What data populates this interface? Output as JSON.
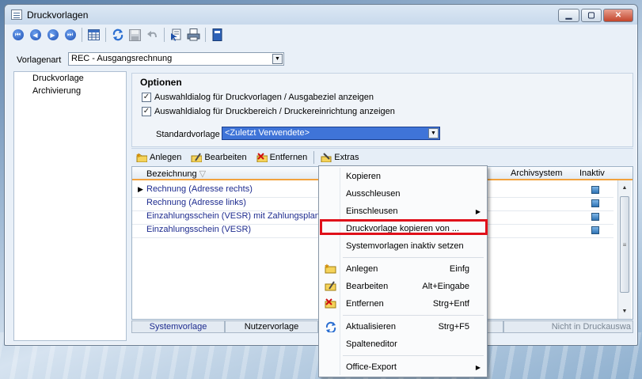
{
  "window": {
    "title": "Druckvorlagen"
  },
  "vorlagenart": {
    "label": "Vorlagenart",
    "value": "REC - Ausgangsrechnung"
  },
  "side": {
    "items": [
      "Druckvorlage",
      "Archivierung"
    ]
  },
  "optionen": {
    "title": "Optionen",
    "checkbox1": "Auswahldialog für Druckvorlagen / Ausgabeziel anzeigen",
    "checkbox2": "Auswahldialog für Druckbereich / Druckereinrichtung anzeigen",
    "std_label": "Standardvorlage",
    "std_value": "<Zuletzt Verwendete>"
  },
  "gridtb": {
    "anlegen": "Anlegen",
    "bearbeiten": "Bearbeiten",
    "entfernen": "Entfernen",
    "extras": "Extras"
  },
  "grid": {
    "col_bez": "Bezeichnung",
    "col_archiv": "Archivsystem",
    "col_inaktiv": "Inaktiv",
    "rows": [
      "Rechnung (Adresse rechts)",
      "Rechnung (Adresse links)",
      "Einzahlungsschein (VESR) mit Zahlungsplan",
      "Einzahlungsschein (VESR)"
    ]
  },
  "status": {
    "sys": "Systemvorlage",
    "nutz": "Nutzervorlage",
    "nicht": "Nicht in Druckauswa"
  },
  "menu": {
    "kopieren": "Kopieren",
    "ausschleusen": "Ausschleusen",
    "einschleusen": "Einschleusen",
    "druckvorlage_kopieren": "Druckvorlage kopieren von ...",
    "systemvorlagen_inaktiv": "Systemvorlagen inaktiv setzen",
    "anlegen": "Anlegen",
    "anlegen_sc": "Einfg",
    "bearbeiten": "Bearbeiten",
    "bearbeiten_sc": "Alt+Eingabe",
    "entfernen": "Entfernen",
    "entfernen_sc": "Strg+Entf",
    "aktualisieren": "Aktualisieren",
    "aktualisieren_sc": "Strg+F5",
    "spalteneditor": "Spalteneditor",
    "office_export": "Office-Export"
  },
  "colors": {
    "highlight": "#e0101a",
    "selection": "#3f74d8",
    "link_text": "#1d2b8f"
  }
}
